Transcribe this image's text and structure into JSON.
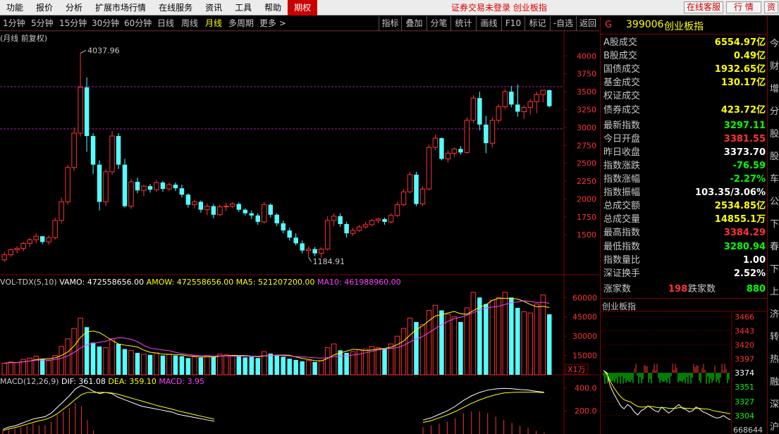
{
  "menu": {
    "items": [
      "功能",
      "报价",
      "分析",
      "扩展市场行情",
      "在线服务",
      "资讯",
      "工具",
      "帮助",
      "期权"
    ],
    "notice": "证券交易未登录  创业板指",
    "btn_service": "在线客服",
    "btn_quote": "行  情",
    "btn_info": "资"
  },
  "toolbar": {
    "timeframes": [
      "1分钟",
      "5分钟",
      "15分钟",
      "30分钟",
      "60分钟",
      "日线",
      "周线",
      "月线",
      "多周期",
      "更多 >"
    ],
    "selected": "月线",
    "tools": [
      "指标",
      "叠加",
      "分笔",
      "统计",
      "画线",
      "F10",
      "标记",
      "-自选",
      "返回"
    ]
  },
  "main_chart": {
    "title": "(月线 前复权)",
    "high_label": "4037.96",
    "low_label": "1184.91",
    "yticks": [
      "4000",
      "3750",
      "3500",
      "3250",
      "3000",
      "2750",
      "2500",
      "2250",
      "2000",
      "1750",
      "1500"
    ],
    "ytick_values": [
      4000,
      3750,
      3500,
      3250,
      3000,
      2750,
      2500,
      2250,
      2000,
      1750,
      1500
    ]
  },
  "volume_panel": {
    "title": "VOL-TDX(5,10)",
    "items": [
      {
        "label": "VAMO: 472558656.00",
        "color": "#ffffff"
      },
      {
        "label": "AMOW: 472558656.00",
        "color": "#ffff00"
      },
      {
        "label": "MA5: 521207200.00",
        "color": "#ffff00"
      },
      {
        "label": "MA10: 461988960.00",
        "color": "#ff40ff"
      }
    ],
    "yticks": [
      "60000",
      "45000",
      "30000",
      "15000"
    ],
    "ytick_values": [
      60000,
      45000,
      30000,
      15000
    ],
    "unit": "X1万"
  },
  "macd_panel": {
    "title": "MACD(12,26,9)",
    "items": [
      {
        "label": "DIF: 361.08",
        "color": "#ffffff"
      },
      {
        "label": "DEA: 359.10",
        "color": "#ffff00"
      },
      {
        "label": "MACD: 3.95",
        "color": "#ff40ff"
      }
    ],
    "yticks": [
      "400.0",
      "200.0"
    ],
    "ytick_values": [
      400,
      200
    ]
  },
  "quote_panel": {
    "marker": "G",
    "code": "399006",
    "name": "创业板指",
    "rows": [
      {
        "label": "A股成交",
        "value": "6554.97亿",
        "color": "#ffff00"
      },
      {
        "label": "B股成交",
        "value": "0.49亿",
        "color": "#ffff00"
      },
      {
        "label": "国债成交",
        "value": "1932.65亿",
        "color": "#ffff00"
      },
      {
        "label": "基金成交",
        "value": "130.17亿",
        "color": "#ffff00"
      },
      {
        "label": "权证成交",
        "value": "",
        "color": "#ffff00"
      },
      {
        "label": "债券成交",
        "value": "423.72亿",
        "color": "#ffff00"
      },
      {
        "label": "最新指数",
        "value": "3297.11",
        "color": "#00ff00"
      },
      {
        "label": "今日开盘",
        "value": "3381.55",
        "color": "#ff3232"
      },
      {
        "label": "昨日收盘",
        "value": "3373.70",
        "color": "#ffffff"
      },
      {
        "label": "指数涨跌",
        "value": "-76.59",
        "color": "#00ff00"
      },
      {
        "label": "指数涨幅",
        "value": "-2.27%",
        "color": "#00ff00"
      },
      {
        "label": "指数振幅",
        "value": "103.35/3.06%",
        "color": "#ffffff"
      },
      {
        "label": "总成交额",
        "value": "2534.85亿",
        "color": "#ffff00"
      },
      {
        "label": "总成交量",
        "value": "14855.1万",
        "color": "#ffff00"
      },
      {
        "label": "最高指数",
        "value": "3384.29",
        "color": "#ff3232"
      },
      {
        "label": "最低指数",
        "value": "3280.94",
        "color": "#00ff00"
      },
      {
        "label": "指数量比",
        "value": "1.00",
        "color": "#ffffff"
      },
      {
        "label": "深证换手",
        "value": "2.52%",
        "color": "#ffffff"
      }
    ],
    "up_label": "涨家数",
    "up_count": "198",
    "down_label": "跌家数",
    "down_count": "880"
  },
  "mini_chart": {
    "title": "创业板指",
    "yticks": [
      "3466",
      "3443",
      "3420",
      "3397",
      "3374",
      "3351",
      "3327",
      "3304"
    ],
    "ytick_values": [
      3466,
      3443,
      3420,
      3397,
      3374,
      3351,
      3327,
      3304
    ],
    "vol_label": "668644"
  },
  "far_right": {
    "chars": [
      "今",
      "财",
      "增",
      "分",
      "股",
      "股",
      "车",
      "公",
      "下",
      "春",
      "下",
      "上",
      "济",
      "转",
      "热",
      "融",
      "深",
      "沪"
    ]
  },
  "chart_data": {
    "type": "candlestick",
    "title": "(月线 前复权)",
    "ylim": [
      1000,
      4200
    ],
    "note_high": 4037.96,
    "note_low": 1184.91,
    "candles": [
      [
        1150,
        1260,
        1120,
        1220
      ],
      [
        1220,
        1310,
        1190,
        1290
      ],
      [
        1290,
        1340,
        1240,
        1310
      ],
      [
        1310,
        1400,
        1270,
        1380
      ],
      [
        1380,
        1460,
        1330,
        1430
      ],
      [
        1430,
        1520,
        1380,
        1480
      ],
      [
        1480,
        1460,
        1370,
        1400
      ],
      [
        1400,
        1490,
        1360,
        1460
      ],
      [
        1460,
        1740,
        1430,
        1700
      ],
      [
        1700,
        2020,
        1660,
        1960
      ],
      [
        1960,
        2480,
        1920,
        2440
      ],
      [
        2440,
        3000,
        2390,
        2920
      ],
      [
        2920,
        4037.96,
        2870,
        3560
      ],
      [
        3560,
        3700,
        2660,
        2880
      ],
      [
        2880,
        2920,
        2350,
        2480
      ],
      [
        2480,
        2540,
        1840,
        1960
      ],
      [
        1960,
        2420,
        1900,
        2380
      ],
      [
        2380,
        2950,
        2340,
        2880
      ],
      [
        2880,
        2920,
        2420,
        2480
      ],
      [
        2480,
        2560,
        1880,
        1900
      ],
      [
        1900,
        2280,
        1860,
        2240
      ],
      [
        2240,
        2300,
        2080,
        2120
      ],
      [
        2120,
        2200,
        2040,
        2180
      ],
      [
        2180,
        2210,
        2090,
        2130
      ],
      [
        2130,
        2270,
        2100,
        2230
      ],
      [
        2230,
        2250,
        2100,
        2140
      ],
      [
        2140,
        2230,
        2110,
        2200
      ],
      [
        2200,
        2230,
        2110,
        2150
      ],
      [
        2150,
        2200,
        2020,
        2060
      ],
      [
        2060,
        2080,
        1880,
        1920
      ],
      [
        1920,
        1990,
        1870,
        1960
      ],
      [
        1960,
        1980,
        1810,
        1850
      ],
      [
        1850,
        1940,
        1770,
        1900
      ],
      [
        1900,
        1930,
        1730,
        1780
      ],
      [
        1780,
        1920,
        1760,
        1890
      ],
      [
        1890,
        1950,
        1830,
        1900
      ],
      [
        1900,
        1960,
        1870,
        1930
      ],
      [
        1930,
        1950,
        1820,
        1850
      ],
      [
        1850,
        1870,
        1770,
        1800
      ],
      [
        1800,
        1840,
        1720,
        1770
      ],
      [
        1770,
        1800,
        1640,
        1680
      ],
      [
        1680,
        1960,
        1660,
        1920
      ],
      [
        1920,
        1940,
        1740,
        1780
      ],
      [
        1780,
        1800,
        1620,
        1660
      ],
      [
        1660,
        1700,
        1520,
        1560
      ],
      [
        1560,
        1600,
        1420,
        1460
      ],
      [
        1460,
        1520,
        1350,
        1380
      ],
      [
        1380,
        1420,
        1240,
        1280
      ],
      [
        1280,
        1340,
        1184.91,
        1300
      ],
      [
        1300,
        1330,
        1200,
        1240
      ],
      [
        1240,
        1330,
        1180,
        1300
      ],
      [
        1300,
        1760,
        1280,
        1700
      ],
      [
        1700,
        1800,
        1620,
        1760
      ],
      [
        1760,
        1800,
        1610,
        1650
      ],
      [
        1650,
        1680,
        1460,
        1520
      ],
      [
        1520,
        1600,
        1480,
        1560
      ],
      [
        1560,
        1640,
        1540,
        1610
      ],
      [
        1610,
        1680,
        1590,
        1640
      ],
      [
        1640,
        1720,
        1620,
        1700
      ],
      [
        1700,
        1740,
        1660,
        1720
      ],
      [
        1720,
        1740,
        1640,
        1680
      ],
      [
        1680,
        1800,
        1660,
        1770
      ],
      [
        1770,
        1960,
        1750,
        1920
      ],
      [
        1920,
        2140,
        1900,
        2100
      ],
      [
        2100,
        2380,
        2080,
        2340
      ],
      [
        2340,
        2380,
        1900,
        1930
      ],
      [
        1930,
        2180,
        1900,
        2140
      ],
      [
        2140,
        2760,
        2120,
        2720
      ],
      [
        2720,
        2900,
        2680,
        2850
      ],
      [
        2850,
        2860,
        2540,
        2560
      ],
      [
        2560,
        2680,
        2510,
        2640
      ],
      [
        2640,
        2720,
        2580,
        2700
      ],
      [
        2700,
        2740,
        2620,
        2650
      ],
      [
        2650,
        3140,
        2630,
        3100
      ],
      [
        3100,
        3450,
        3060,
        3410
      ],
      [
        3410,
        3500,
        2960,
        3040
      ],
      [
        3040,
        3160,
        2640,
        2780
      ],
      [
        2780,
        3140,
        2720,
        3100
      ],
      [
        3100,
        3330,
        3060,
        3290
      ],
      [
        3290,
        3540,
        3250,
        3500
      ],
      [
        3500,
        3580,
        3280,
        3320
      ],
      [
        3320,
        3600,
        3150,
        3220
      ],
      [
        3220,
        3310,
        3120,
        3280
      ],
      [
        3280,
        3400,
        3180,
        3360
      ],
      [
        3360,
        3500,
        3200,
        3460
      ],
      [
        3460,
        3520,
        3350,
        3520
      ],
      [
        3520,
        3530,
        3280,
        3297.11
      ]
    ],
    "volume": [
      9000,
      10000,
      9500,
      12000,
      13000,
      14500,
      12500,
      11000,
      15000,
      22000,
      28000,
      36000,
      44000,
      37000,
      25000,
      22000,
      21000,
      28000,
      24000,
      20000,
      19000,
      17000,
      16000,
      15500,
      17000,
      15000,
      16000,
      15000,
      14500,
      13000,
      14000,
      13500,
      15000,
      14000,
      16000,
      15500,
      15000,
      14500,
      13500,
      14000,
      13000,
      18000,
      16500,
      15000,
      14000,
      12500,
      11500,
      10500,
      11000,
      10000,
      11000,
      21000,
      24000,
      19000,
      17000,
      18000,
      19500,
      20000,
      22000,
      21000,
      20000,
      24000,
      30000,
      36000,
      44000,
      41000,
      39000,
      50000,
      54000,
      50000,
      47000,
      45000,
      41000,
      52000,
      64000,
      60000,
      55000,
      58000,
      60000,
      64000,
      60000,
      52000,
      49000,
      48000,
      55000,
      62000,
      47000
    ],
    "macd_dif": [
      40,
      60,
      70,
      90,
      110,
      130,
      140,
      150,
      180,
      230,
      280,
      330,
      390,
      420,
      400,
      370,
      350,
      360,
      350,
      320,
      300,
      280,
      260,
      240,
      230,
      220,
      210,
      200,
      190,
      170,
      160,
      150,
      140,
      130,
      120,
      110
    ],
    "macd_dea": [
      30,
      45,
      55,
      70,
      85,
      100,
      115,
      125,
      145,
      175,
      215,
      255,
      300,
      340,
      360,
      360,
      360,
      360,
      355,
      345,
      330,
      315,
      300,
      285,
      270,
      255,
      240,
      228,
      215,
      200,
      188,
      176,
      164,
      152,
      140,
      128
    ],
    "macd_dif_right": [
      120,
      140,
      170,
      200,
      240,
      290,
      330,
      360,
      380,
      390,
      395,
      392,
      385,
      380,
      370,
      361.08
    ],
    "macd_dea_right": [
      100,
      115,
      140,
      165,
      195,
      230,
      265,
      295,
      320,
      340,
      355,
      360,
      362,
      362,
      361,
      359.1
    ],
    "mini_price": [
      3378,
      3374,
      3352,
      3340,
      3330,
      3320,
      3315,
      3322,
      3318,
      3310,
      3305,
      3312,
      3315,
      3320,
      3316,
      3312,
      3310,
      3318,
      3313,
      3308,
      3312,
      3318,
      3322,
      3316,
      3314,
      3310,
      3312,
      3318,
      3315,
      3310,
      3308,
      3305,
      3302,
      3300,
      3301,
      3304,
      3300,
      3297.11
    ],
    "mini_avg": [
      3378,
      3372,
      3360,
      3350,
      3342,
      3335,
      3330,
      3328,
      3326,
      3322,
      3319,
      3318,
      3318,
      3319,
      3319,
      3318,
      3317,
      3317,
      3317,
      3316,
      3316,
      3316,
      3317,
      3317,
      3316,
      3316,
      3315,
      3316,
      3316,
      3315,
      3315,
      3314,
      3312,
      3311,
      3310,
      3309,
      3308,
      3307
    ]
  }
}
